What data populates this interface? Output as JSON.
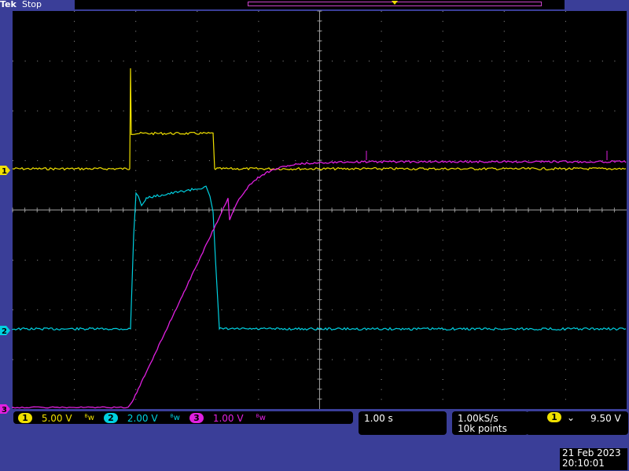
{
  "header": {
    "brand": "Tek",
    "status": "Stop"
  },
  "channels": [
    {
      "id": "1",
      "marker": "1",
      "scale": "5.00 V",
      "color": "#f0e000",
      "coupling_icon": "bandwidth-limit-icon"
    },
    {
      "id": "2",
      "marker": "2",
      "scale": "2.00 V",
      "color": "#00d0e0",
      "coupling_icon": "bandwidth-limit-icon"
    },
    {
      "id": "3",
      "marker": "3",
      "scale": "1.00 V",
      "color": "#e020e0",
      "coupling_icon": "bandwidth-limit-icon"
    }
  ],
  "timebase": {
    "scale": "1.00 s"
  },
  "acquisition": {
    "sample_rate": "1.00kS/s",
    "record_length": "10k points"
  },
  "trigger": {
    "source": "1",
    "slope_icon": "falling-edge-icon",
    "level": "9.50 V"
  },
  "timestamp": {
    "date": "21 Feb  2023",
    "time": "20:10:01"
  },
  "colors": {
    "background": "#3a3e98",
    "graticule": "#000000",
    "grid_dots": "#9a9a9a"
  }
}
